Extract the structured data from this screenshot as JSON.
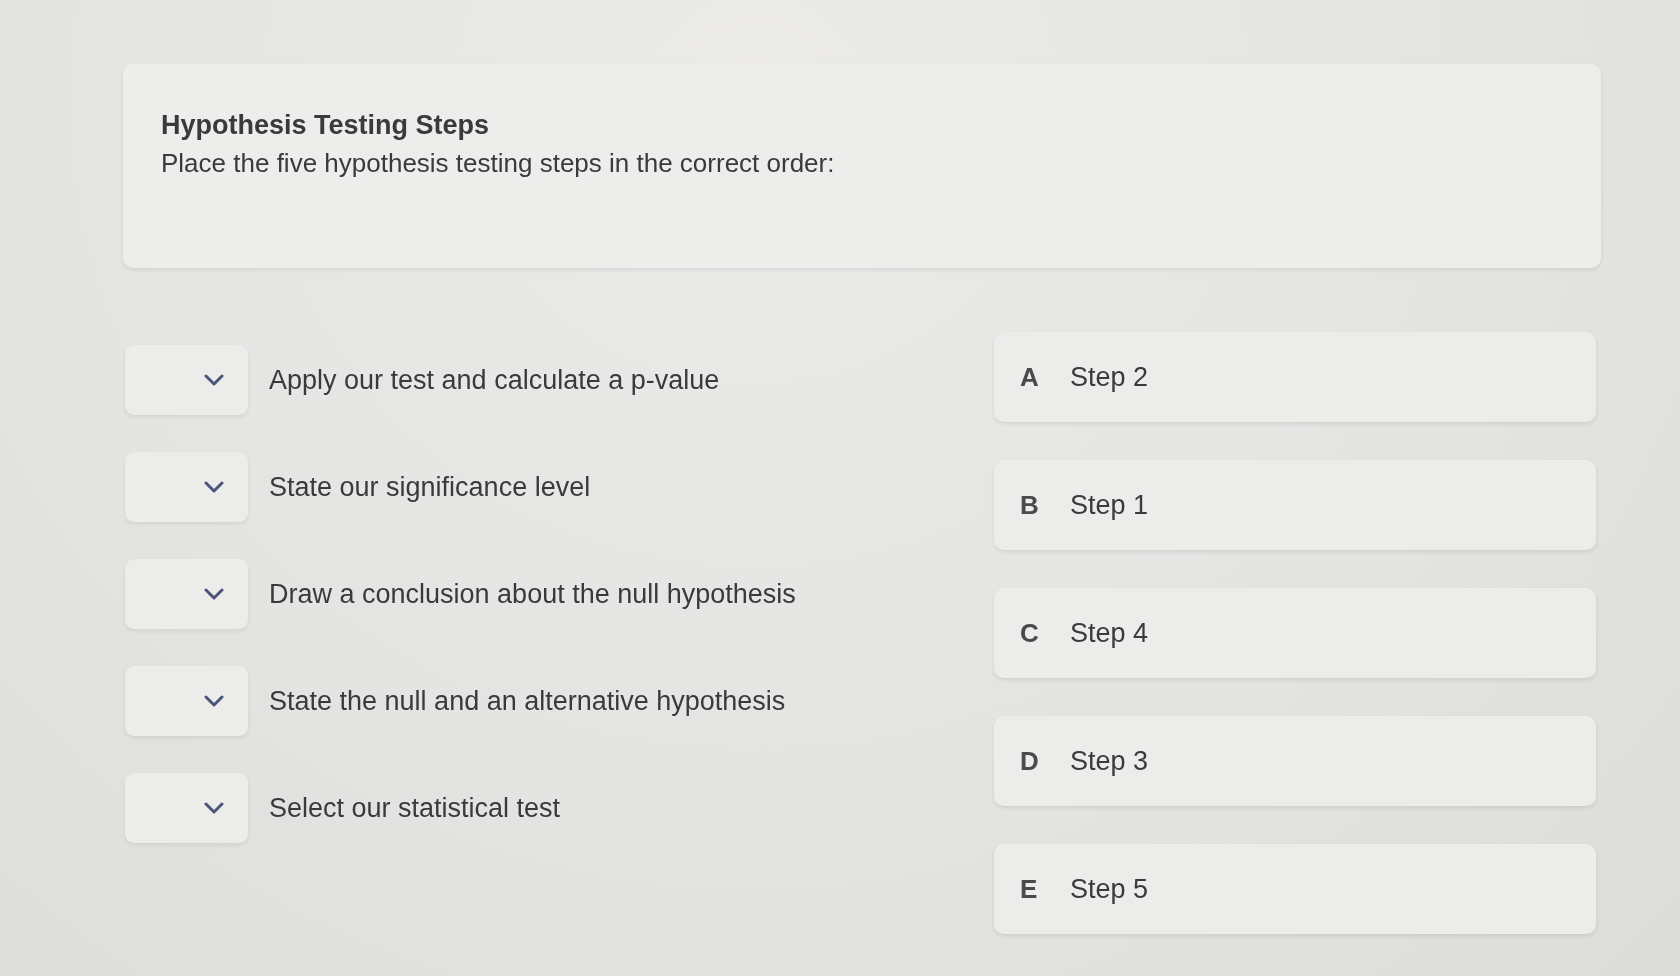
{
  "question": {
    "title": "Hypothesis Testing Steps",
    "prompt": "Place the five hypothesis testing steps in the correct order:"
  },
  "items": [
    {
      "text": "Apply our test and calculate a p-value"
    },
    {
      "text": "State our significance level"
    },
    {
      "text": "Draw a conclusion about the null hypothesis"
    },
    {
      "text": "State the null and an alternative hypothesis"
    },
    {
      "text": "Select our statistical test"
    }
  ],
  "options": [
    {
      "letter": "A",
      "label": "Step 2"
    },
    {
      "letter": "B",
      "label": "Step 1"
    },
    {
      "letter": "C",
      "label": "Step 4"
    },
    {
      "letter": "D",
      "label": "Step 3"
    },
    {
      "letter": "E",
      "label": "Step 5"
    }
  ]
}
